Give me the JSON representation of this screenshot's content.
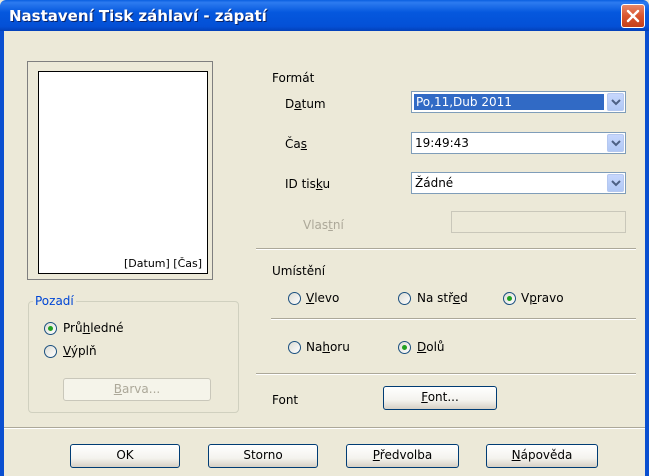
{
  "window": {
    "title": "Nastavení Tisk záhlaví - zápatí"
  },
  "preview": {
    "label": "[Datum] [Čas]"
  },
  "background_group": {
    "title": "Pozadí",
    "options": [
      {
        "label_pre": "Prů",
        "label_u": "h",
        "label_post": "ledné",
        "checked": true
      },
      {
        "label_pre": "",
        "label_u": "V",
        "label_post": "ýplň",
        "checked": false
      }
    ],
    "color_button": {
      "label_pre": "",
      "label_u": "B",
      "label_post": "arva...",
      "enabled": false
    }
  },
  "format": {
    "title": "Formát",
    "date": {
      "label_pre": "D",
      "label_u": "a",
      "label_post": "tum",
      "value": "Po,11,Dub 2011"
    },
    "time": {
      "label_pre": "Ča",
      "label_u": "s",
      "label_post": "",
      "value": "19:49:43"
    },
    "print_id": {
      "label_pre": "ID tis",
      "label_u": "k",
      "label_post": "u",
      "value": "Žádné"
    },
    "custom": {
      "label_pre": "Vlas",
      "label_u": "t",
      "label_post": "ní",
      "value": "",
      "enabled": false
    }
  },
  "placement": {
    "title": "Umístění",
    "horizontal": [
      {
        "label_pre": "",
        "label_u": "V",
        "label_post": "levo",
        "checked": false
      },
      {
        "label_pre": "Na stř",
        "label_u": "e",
        "label_post": "d",
        "checked": false
      },
      {
        "label_pre": "V",
        "label_u": "p",
        "label_post": "ravo",
        "checked": true
      }
    ],
    "vertical": [
      {
        "label_pre": "Na",
        "label_u": "h",
        "label_post": "oru",
        "checked": false
      },
      {
        "label_pre": "",
        "label_u": "D",
        "label_post": "olů",
        "checked": true
      }
    ]
  },
  "font": {
    "label": "Font",
    "button": {
      "label_pre": "",
      "label_u": "F",
      "label_post": "ont..."
    }
  },
  "footer_buttons": [
    {
      "label_pre": "OK",
      "label_u": "",
      "label_post": ""
    },
    {
      "label_pre": "Storno",
      "label_u": "",
      "label_post": ""
    },
    {
      "label_pre": "",
      "label_u": "P",
      "label_post": "ředvolba"
    },
    {
      "label_pre": "",
      "label_u": "N",
      "label_post": "ápověda"
    }
  ],
  "colors": {
    "titlebar": "#0558de",
    "face": "#ece9d8",
    "selection": "#316ac5",
    "group_title": "#0046d5"
  }
}
